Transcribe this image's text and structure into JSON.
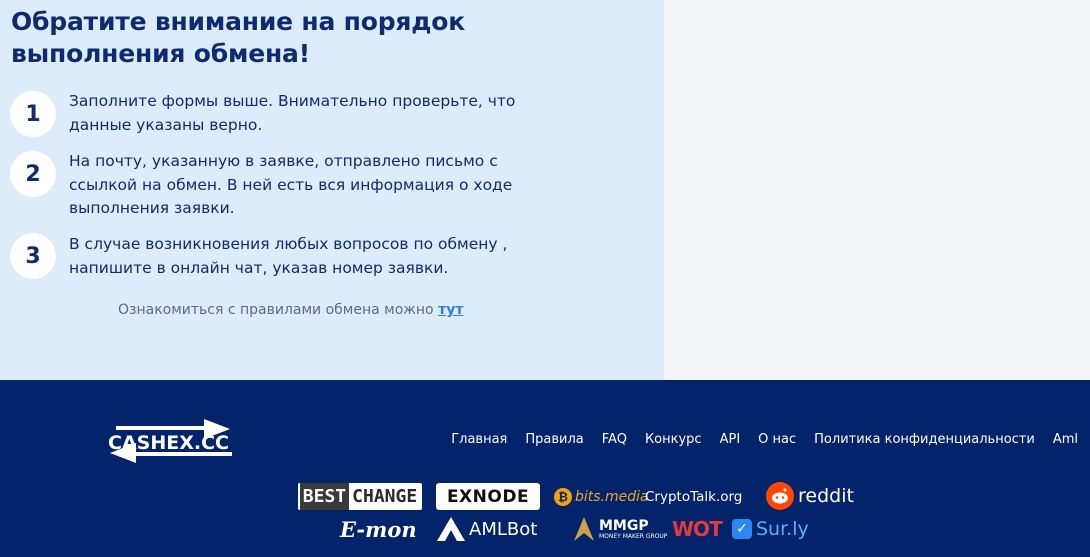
{
  "info": {
    "title": "Обратите внимание на порядок выполнения обмена!",
    "steps": [
      {
        "num": "1",
        "text": "Заполните формы выше. Внимательно проверьте, что данные указаны верно."
      },
      {
        "num": "2",
        "text": "На почту, указанную в заявке, отправлено письмо с ссылкой на обмен. В ней есть вся информация о ходе выполнения заявки."
      },
      {
        "num": "3",
        "text": "В случае возникновения любых вопросов по обмену , напишите в онлайн чат, указав номер заявки."
      }
    ],
    "rules_text": "Ознакомиться с правилами обмена можно",
    "rules_link": "тут"
  },
  "footer": {
    "logo_text": "CASHEX.CC",
    "nav": [
      "Главная",
      "Правила",
      "FAQ",
      "Конкурс",
      "API",
      "О нас",
      "Политика конфиденциальности",
      "Aml"
    ],
    "partners": {
      "bestchange_a": "BEST",
      "bestchange_b": "CHANGE",
      "exnode": "EXNODE",
      "bitsmedia": "bits.media",
      "cryptotalk": "CryptoTalk.org",
      "reddit": "reddit",
      "emon": "E-mon",
      "amlbot": "AMLBot",
      "mmgp": "MMGP",
      "mmgp_sub": "MONEY MAKER GROUP",
      "wot": "WOT",
      "surly": "Sur.ly"
    }
  },
  "colors": {
    "info_bg": "#dcecfb",
    "title": "#0f2a6e",
    "footer_bg": "#03236b",
    "link": "#2f7de0"
  }
}
